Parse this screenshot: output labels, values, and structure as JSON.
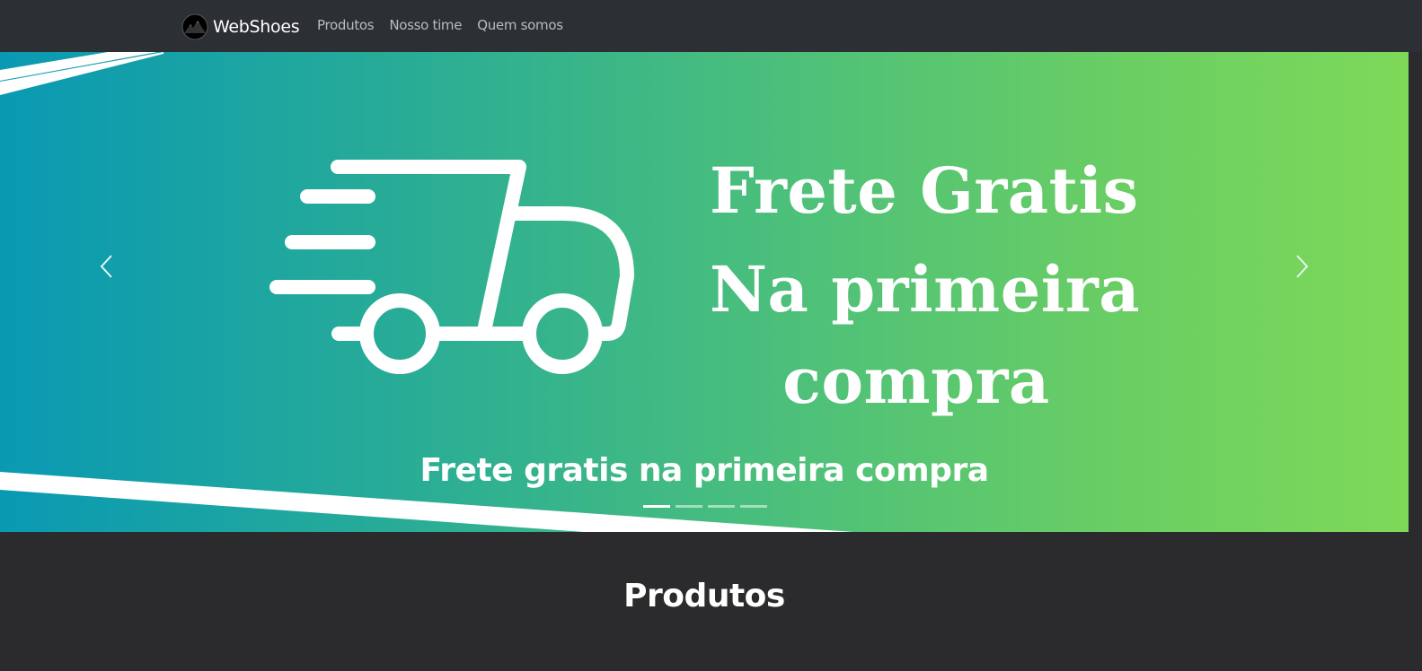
{
  "brand": {
    "name": "WebShoes",
    "logo_icon": "mountain-logo-icon"
  },
  "nav": {
    "items": [
      "Produtos",
      "Nosso time",
      "Quem somos"
    ]
  },
  "carousel": {
    "headline_lines": [
      "Frete Gratis",
      "Na primeira",
      "compra"
    ],
    "caption": "Frete gratis na primeira compra",
    "slide_icon": "delivery-truck-icon",
    "prev_icon": "chevron-left-icon",
    "next_icon": "chevron-right-icon",
    "indicator_count": 4,
    "active_indicator": 0,
    "gradient": [
      "#0999b3",
      "#7ed959"
    ]
  },
  "section": {
    "title": "Produtos"
  },
  "colors": {
    "navbar": "#2c2f33",
    "page_bg": "#2b2b2d",
    "text": "#ffffff",
    "nav_link": "#b9bcbf"
  }
}
